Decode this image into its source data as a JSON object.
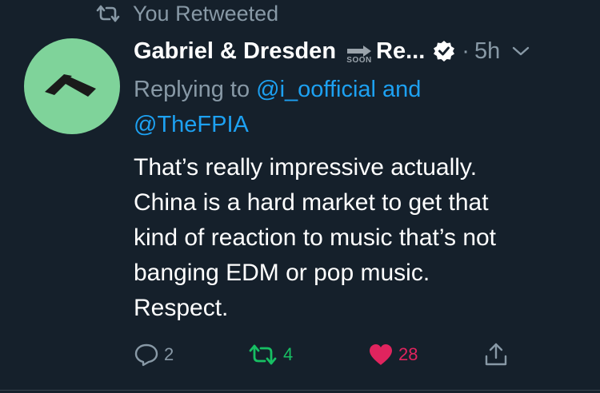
{
  "retweet_context": {
    "icon": "retweet-icon",
    "text": "You Retweeted"
  },
  "author": {
    "avatar_color": "#7fd39a",
    "display_name": "Gabriel & Dresden",
    "soon_emoji_text": "SOON",
    "name_suffix": "Re...",
    "verified": true,
    "separator": "·",
    "time": "5h"
  },
  "reply": {
    "prefix": "Replying to",
    "mention1": "@i_oofficial",
    "conjunction": "and",
    "mention2": "@TheFPIA"
  },
  "tweet": {
    "lines": [
      "That’s really impressive actually.",
      "China is a hard market to get that",
      "kind of reaction to music that’s not",
      "banging EDM or pop music.",
      "Respect."
    ]
  },
  "actions": {
    "reply_count": "2",
    "retweet_count": "4",
    "like_count": "28"
  },
  "colors": {
    "background": "#15202b",
    "muted": "#8899a6",
    "link": "#1da1f2",
    "retweet_active": "#17bf63",
    "like_active": "#e0245e"
  }
}
